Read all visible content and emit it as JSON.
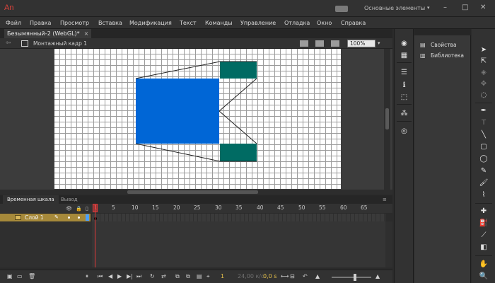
{
  "app": {
    "logo": "An",
    "workspace": "Основные элементы"
  },
  "menu": [
    "Файл",
    "Правка",
    "Просмотр",
    "Вставка",
    "Модификация",
    "Текст",
    "Команды",
    "Управление",
    "Отладка",
    "Окно",
    "Справка"
  ],
  "document": {
    "tab_title": "Безымянный-2 (WebGL)*",
    "close_symbol": "×"
  },
  "editbar": {
    "scene": "Монтажный кадр 1",
    "zoom": "100%"
  },
  "stage": {
    "colors": {
      "blue_rect": "#0066d6",
      "teal_rect": "#006b63",
      "stroke": "#222222"
    }
  },
  "timeline": {
    "tabs": [
      "Временная шкала",
      "Вывод"
    ],
    "frame_numbers": [
      "1",
      "5",
      "10",
      "15",
      "20",
      "25",
      "30",
      "35",
      "40",
      "45",
      "50",
      "55",
      "60",
      "65"
    ],
    "current_frame": "1",
    "layer": {
      "name": "Слой 1"
    },
    "footer": {
      "frame": "1",
      "fps": "24,00 к/с",
      "time": "0,0 s"
    }
  },
  "panels": {
    "properties": "Свойства",
    "library": "Библиотека"
  },
  "icons": [
    "eye-icon",
    "lock-icon",
    "outline-icon",
    "pencil-icon",
    "play-icon",
    "arrow-tool-icon",
    "lasso-icon",
    "pen-tool-icon",
    "text-tool-icon",
    "brush-icon",
    "bucket-icon",
    "eyedropper-icon",
    "eraser-icon",
    "hand-icon",
    "zoom-icon"
  ]
}
